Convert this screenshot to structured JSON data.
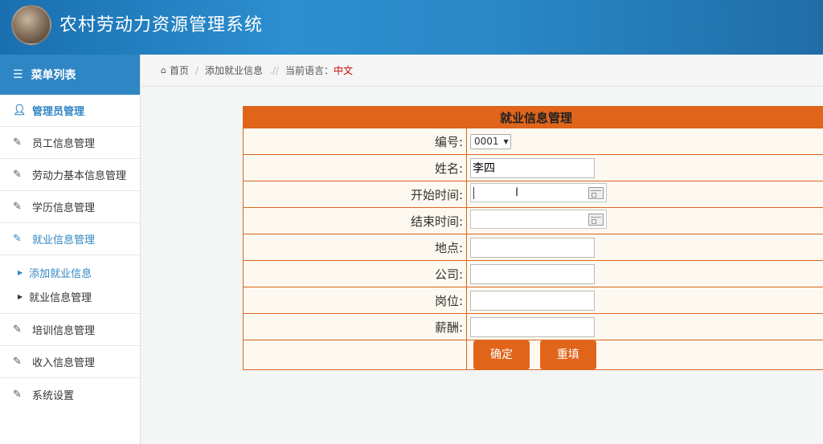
{
  "header": {
    "title": "农村劳动力资源管理系统"
  },
  "sidebar": {
    "menu_title": "菜单列表",
    "items": [
      {
        "label": "管理员管理",
        "icon": "user-icon"
      },
      {
        "label": "员工信息管理",
        "icon": "edit-icon"
      },
      {
        "label": "劳动力基本信息管理",
        "icon": "edit-icon"
      },
      {
        "label": "学历信息管理",
        "icon": "edit-icon"
      },
      {
        "label": "就业信息管理",
        "icon": "edit-icon"
      },
      {
        "label": "培训信息管理",
        "icon": "edit-icon"
      },
      {
        "label": "收入信息管理",
        "icon": "edit-icon"
      },
      {
        "label": "系统设置",
        "icon": "edit-icon"
      }
    ],
    "submenu": [
      {
        "label": "添加就业信息"
      },
      {
        "label": "就业信息管理"
      }
    ]
  },
  "breadcrumb": {
    "home": "首页",
    "page": "添加就业信息",
    "lang_label": "当前语言：",
    "lang_value": "中文"
  },
  "form": {
    "title": "就业信息管理",
    "id_label": "编号:",
    "id_value": "0001",
    "name_label": "姓名:",
    "name_value": "李四",
    "start_label": "开始时间:",
    "start_value": "",
    "end_label": "结束时间:",
    "end_value": "",
    "location_label": "地点:",
    "location_value": "",
    "company_label": "公司:",
    "company_value": "",
    "position_label": "岗位:",
    "position_value": "",
    "salary_label": "薪酬:",
    "salary_value": "",
    "submit_label": "确定",
    "reset_label": "重填"
  },
  "colors": {
    "header": "#2c8fcf",
    "accent": "#e0651a",
    "link": "#2f86c4",
    "lang": "#cc0000"
  }
}
